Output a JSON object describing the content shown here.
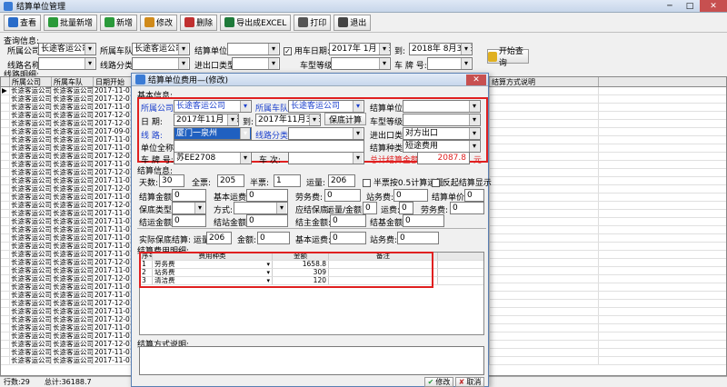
{
  "window": {
    "title": "结算单位管理"
  },
  "toolbar": [
    {
      "name": "view-button",
      "label": "查看",
      "color": "#2a6cc9"
    },
    {
      "name": "batch-add-button",
      "label": "批量新增",
      "color": "#2a9a3a"
    },
    {
      "name": "add-button",
      "label": "新增",
      "color": "#2a9a3a"
    },
    {
      "name": "edit-button",
      "label": "修改",
      "color": "#d08a1a"
    },
    {
      "name": "delete-button",
      "label": "删除",
      "color": "#c03030"
    },
    {
      "name": "export-excel-button",
      "label": "导出成EXCEL",
      "color": "#1e7a3a"
    },
    {
      "name": "print-button",
      "label": "打印",
      "color": "#555555"
    },
    {
      "name": "exit-button",
      "label": "退出",
      "color": "#444444"
    }
  ],
  "query": {
    "section": "查询信息:",
    "company_label": "所属公司:",
    "company": "长途客运公司",
    "fleet_label": "所属车队:",
    "fleet": "长途客运公司",
    "unit_label": "结算单位:",
    "use_date_label": "用车日期:",
    "date_from": "2017年 1月 1日",
    "to_label": "到:",
    "date_to": "2018年 8月31日",
    "route_label": "线路名称:",
    "route_type_label": "线路分类:",
    "io_label": "进出口类型:",
    "grade_label": "车型等级:",
    "plate_label": "车 牌 号:",
    "start_button": "开始查询"
  },
  "detail_section": "线路明细:",
  "grid": {
    "columns": [
      "所属公司",
      "所属车队",
      "日期开始",
      "结算方式说明"
    ],
    "row_company": "长途客运公司",
    "dates": [
      "2017-11-01",
      "2017-12-01",
      "2017-11-01",
      "2017-12-01",
      "2017-12-01",
      "2017-09-01",
      "2017-11-01",
      "2017-11-01",
      "2017-12-01",
      "2017-11-01",
      "2017-12-01",
      "2017-11-01",
      "2017-12-01",
      "2017-11-01",
      "2017-12-01",
      "2017-11-01",
      "2017-11-01",
      "2017-11-01",
      "2017-11-01",
      "2017-11-01",
      "2017-11-01",
      "2017-12-01",
      "2017-11-01",
      "2017-12-01",
      "2017-11-01",
      "2017-11-01",
      "2017-12-01",
      "2017-11-01",
      "2017-12-01",
      "2017-11-01",
      "2017-11-01",
      "2017-12-01",
      "2017-11-01",
      "2017-11-01"
    ]
  },
  "status": {
    "rows": "行数:29",
    "total": "总计:36188.7"
  },
  "dialog": {
    "title": "结算单位费用—(修改)",
    "basic_section": "基本信息:",
    "company_label": "所属公司:",
    "company": "长途客运公司",
    "fleet_label": "所属车队:",
    "fleet": "长途客运公司",
    "unit_label": "结算单位:",
    "date_label": "日 期:",
    "date_from": "2017年11月 1日",
    "to_label": "到:",
    "date_to": "2017年11月30日",
    "calc_button": "保底计算",
    "grade_label": "车型等级:",
    "route_label": "线 路:",
    "route": "厦门一泉州",
    "route_type_label": "线路分类:",
    "io_label": "进出口类型",
    "io": "对方出口",
    "unit_full_label": "单位全称:",
    "fee_type_label": "结算种类:",
    "fee_type": "短途费用",
    "plate_label": "车 牌 号:",
    "plate": "苏EE2708",
    "trips_label": "车 次:",
    "total_label": "总计结算金额:",
    "total": "2087.8",
    "yuan": "元",
    "settle_section": "结算信息:",
    "days_label": "天数:",
    "days": "30",
    "full_label": "全票:",
    "full": "205",
    "half_label": "半票:",
    "half": "1",
    "volume_label": "运量:",
    "volume": "206",
    "half_calc_label": "半票按0.5计算运量",
    "reverse_label": "反起结算显示",
    "settle_amount_label": "结算金额:",
    "settle_amount": "0",
    "base_fare_label": "基本运费:",
    "base_fare": "0",
    "labor_label": "劳务费:",
    "labor": "0",
    "station_label": "站务费:",
    "station": "0",
    "unit_price_label": "结算单价:",
    "unit_price": "0",
    "guarantee_type_label": "保底类型:",
    "method_label": "方式:",
    "due_label": "应结保底:",
    "vol_amount_label": "运量/金额:",
    "vol_amount": "0",
    "fare_label": "运费:",
    "fare": "0",
    "labor2_label": "劳务费:",
    "labor2": "0",
    "settle_fare_label": "结运金额:",
    "settle_fare": "0",
    "settle_station_label": "结站金额:",
    "settle_station": "0",
    "settle_main_label": "结主金额:",
    "settle_main": "0",
    "settle_base_label": "结基金额:",
    "settle_base": "0",
    "actual_label": "实际保底结算: 运量:",
    "actual_volume": "206",
    "amount_label": "金额:",
    "amount": "0",
    "base2_label": "基本运费:",
    "base2": "0",
    "station2_label": "站务费:",
    "station2": "0",
    "fee_section": "结算费用明细:",
    "fee_columns": [
      "序号",
      "费用种类",
      "金额",
      "备注"
    ],
    "fees": [
      {
        "no": "1",
        "type": "劳务费",
        "amount": "1658.8"
      },
      {
        "no": "2",
        "type": "站务费",
        "amount": "309"
      },
      {
        "no": "3",
        "type": "清洁费",
        "amount": "120"
      }
    ],
    "method_desc_label": "结算方式说明:",
    "ok_button": "修改",
    "cancel_button": "取消"
  }
}
